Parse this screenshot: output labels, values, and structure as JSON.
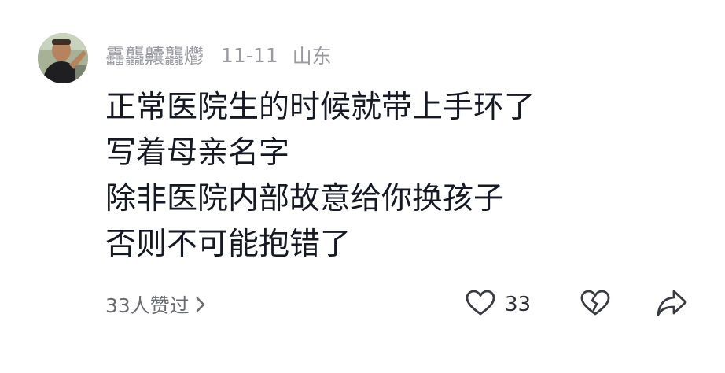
{
  "comment": {
    "author": {
      "name": "靐龘齉龘爩",
      "avatar_icon": "avatar-photo"
    },
    "date": "11-11",
    "location": "山东",
    "lines": [
      "正常医院生的时候就带上手环了",
      "写着母亲名字",
      "除非医院内部故意给你换孩子",
      "否则不可能抱错了"
    ],
    "liked_by_text": "33人赞过",
    "liked_by_icon": "chevron-right-icon",
    "actions": {
      "like": {
        "icon": "heart-outline-icon",
        "count": "33"
      },
      "dislike": {
        "icon": "broken-heart-icon"
      },
      "share": {
        "icon": "share-arrow-icon"
      }
    },
    "colors": {
      "text_primary": "#161823",
      "text_secondary": "#9a9ba0",
      "icon": "#3a3b42"
    }
  }
}
